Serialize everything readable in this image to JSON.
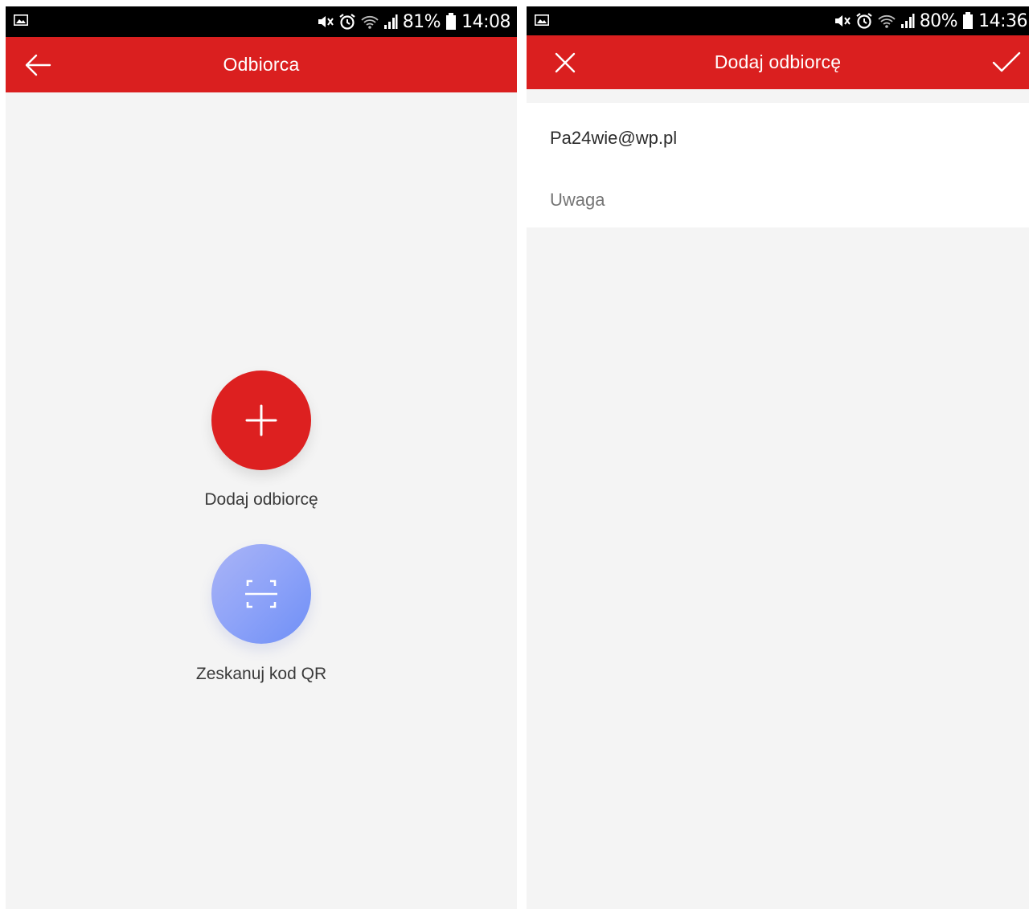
{
  "left": {
    "status_bar": {
      "battery": "81%",
      "time": "14:08"
    },
    "header": {
      "title": "Odbiorca"
    },
    "actions": {
      "add_label": "Dodaj odbiorcę",
      "scan_label": "Zeskanuj kod QR"
    }
  },
  "right": {
    "status_bar": {
      "battery": "80%",
      "time": "14:36"
    },
    "header": {
      "title": "Dodaj odbiorcę"
    },
    "form": {
      "email_value": "Pa24wie@wp.pl",
      "note_placeholder": "Uwaga"
    }
  },
  "icons": {
    "left": [
      "image-icon",
      "mute-icon",
      "alarm-icon",
      "wifi-icon",
      "signal-icon",
      "battery-icon",
      "back-arrow-icon",
      "plus-icon",
      "qr-scan-icon"
    ],
    "right": [
      "image-icon",
      "mute-icon",
      "alarm-icon",
      "wifi-icon",
      "signal-icon",
      "battery-icon",
      "close-icon",
      "check-icon"
    ]
  },
  "colors": {
    "app_bar": "#da1f1f",
    "fab_add": "#dd2020",
    "fab_qr": "#8ea3f8",
    "background": "#f4f4f4"
  }
}
